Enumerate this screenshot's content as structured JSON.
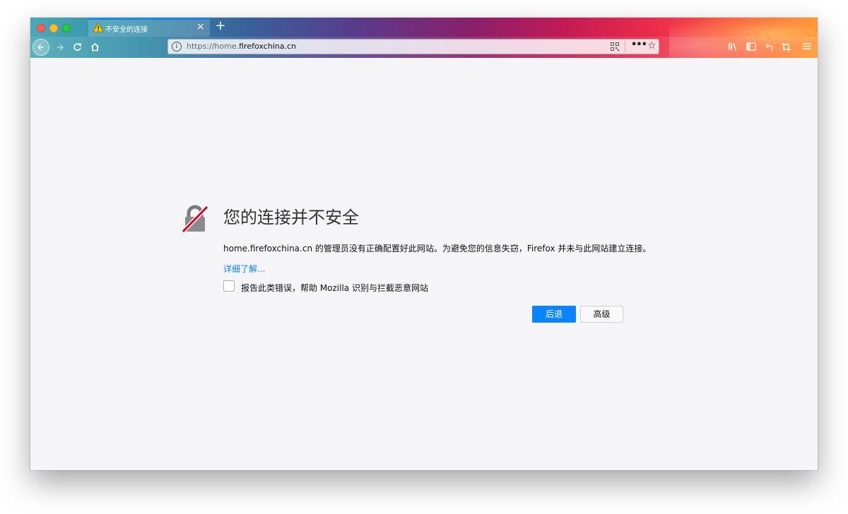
{
  "tab": {
    "title": "不安全的连接",
    "close": "×",
    "new_tab": "+"
  },
  "urlbar": {
    "prefix": "https://home.",
    "host": "firefoxchina.cn",
    "info": "i",
    "more": "•••",
    "star": "☆"
  },
  "error": {
    "title": "您的连接并不安全",
    "description": "home.firefoxchina.cn 的管理员没有正确配置好此网站。为避免您的信息失窃，Firefox 并未与此网站建立连接。",
    "learn_more": "详细了解...",
    "report_label": "报告此类错误，帮助 Mozilla 识别与拦截恶意网站",
    "report_checked": false,
    "back_button": "后退",
    "advanced_button": "高级"
  },
  "colors": {
    "accent": "#0a84ff",
    "lock_slash": "#d70022"
  }
}
